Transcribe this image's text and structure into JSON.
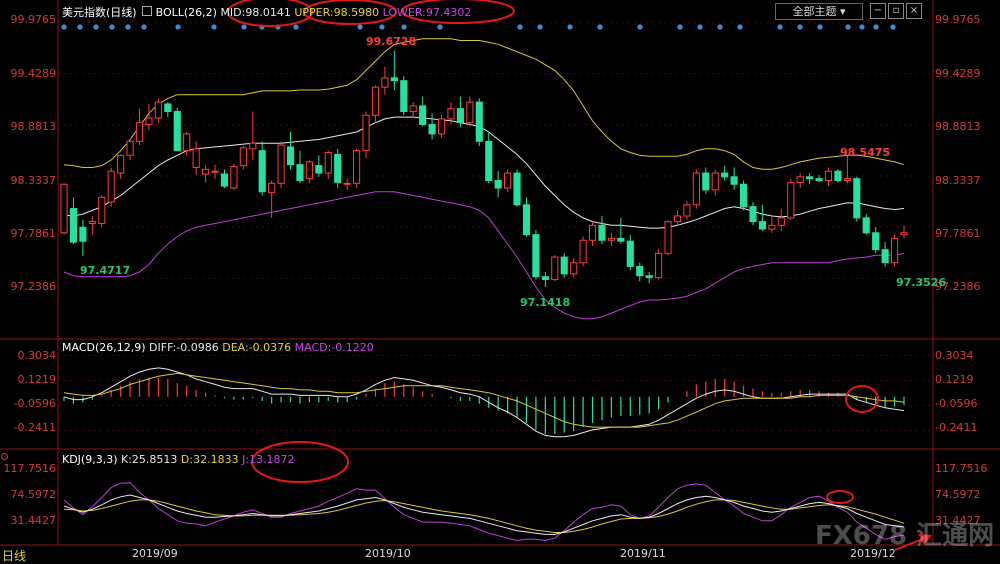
{
  "header": {
    "title": "美元指数",
    "period": "日线",
    "boll_name": "BOLL(26,2)",
    "mid": "MID:98.0141",
    "upper": "UPPER:98.5980",
    "lower": "LOWER:97.4302",
    "theme_btn": "全部主题"
  },
  "macd": {
    "name": "MACD(26,12,9)",
    "diff": "DIFF:-0.0986",
    "dea": "DEA:-0.0376",
    "macd": "MACD:-0.1220"
  },
  "kdj": {
    "name": "KDJ(9,3,3)",
    "k": "K:25.8513",
    "d": "D:32.1833",
    "j": "J:13.1872"
  },
  "axes": {
    "price": [
      "99.9765",
      "99.4289",
      "98.8813",
      "98.3337",
      "97.7861",
      "97.2386"
    ],
    "macd": [
      "0.3034",
      "0.1219",
      "-0.0596",
      "-0.2411"
    ],
    "kdj": [
      "117.7516",
      "74.5972",
      "31.4427"
    ]
  },
  "dates": [
    "2019/09",
    "2019/10",
    "2019/11",
    "2019/12"
  ],
  "bottom_tab": "日线",
  "annotations": {
    "high": "99.6728",
    "low1": "97.4717",
    "low2": "97.1418",
    "peak2": "98.5475",
    "low3": "97.3526"
  },
  "watermark": "FX678 汇通网",
  "colors": {
    "up": "#ff3b3b",
    "down": "#27e0a0",
    "mid": "#e9e9e9",
    "upper": "#d7c832",
    "lower": "#c03cd8",
    "grid": "#7a1010"
  },
  "chart_data": {
    "type": "candlestick",
    "ylim_price": [
      97.0,
      100.0
    ],
    "candles": [
      [
        97.72,
        98.25,
        97.7,
        98.24
      ],
      [
        97.98,
        98.1,
        97.6,
        97.62
      ],
      [
        97.78,
        97.86,
        97.47,
        97.63
      ],
      [
        97.82,
        97.9,
        97.7,
        97.84
      ],
      [
        97.82,
        98.12,
        97.78,
        98.1
      ],
      [
        98.05,
        98.42,
        98.0,
        98.38
      ],
      [
        98.36,
        98.56,
        98.3,
        98.55
      ],
      [
        98.55,
        98.72,
        98.5,
        98.7
      ],
      [
        98.7,
        99.05,
        98.66,
        98.9
      ],
      [
        98.88,
        99.1,
        98.82,
        98.95
      ],
      [
        98.95,
        99.16,
        98.9,
        99.12
      ],
      [
        99.1,
        99.12,
        98.96,
        99.02
      ],
      [
        99.02,
        99.06,
        98.6,
        98.6
      ],
      [
        98.6,
        98.8,
        98.55,
        98.78
      ],
      [
        98.42,
        98.7,
        98.34,
        98.62
      ],
      [
        98.35,
        98.44,
        98.26,
        98.4
      ],
      [
        98.38,
        98.45,
        98.3,
        98.38
      ],
      [
        98.35,
        98.4,
        98.2,
        98.22
      ],
      [
        98.2,
        98.46,
        98.18,
        98.43
      ],
      [
        98.44,
        98.65,
        98.4,
        98.63
      ],
      [
        98.62,
        99.02,
        98.5,
        98.68
      ],
      [
        98.6,
        98.7,
        98.12,
        98.16
      ],
      [
        98.15,
        98.28,
        97.88,
        98.25
      ],
      [
        98.25,
        98.7,
        98.2,
        98.66
      ],
      [
        98.64,
        98.8,
        98.4,
        98.45
      ],
      [
        98.45,
        98.6,
        98.25,
        98.28
      ],
      [
        98.3,
        98.5,
        98.25,
        98.48
      ],
      [
        98.44,
        98.55,
        98.32,
        98.36
      ],
      [
        98.36,
        98.6,
        98.3,
        98.58
      ],
      [
        98.56,
        98.62,
        98.2,
        98.26
      ],
      [
        98.25,
        98.3,
        98.18,
        98.25
      ],
      [
        98.25,
        98.62,
        98.2,
        98.6
      ],
      [
        98.6,
        99.02,
        98.52,
        98.98
      ],
      [
        98.98,
        99.3,
        98.9,
        99.28
      ],
      [
        99.28,
        99.5,
        99.2,
        99.38
      ],
      [
        99.38,
        99.67,
        99.25,
        99.35
      ],
      [
        99.35,
        99.4,
        98.98,
        99.02
      ],
      [
        99.02,
        99.12,
        98.95,
        99.08
      ],
      [
        99.08,
        99.18,
        98.86,
        98.88
      ],
      [
        98.88,
        99.0,
        98.72,
        98.78
      ],
      [
        98.78,
        98.98,
        98.74,
        98.94
      ],
      [
        98.94,
        99.12,
        98.88,
        99.05
      ],
      [
        99.05,
        99.18,
        98.85,
        98.9
      ],
      [
        98.9,
        99.18,
        98.86,
        99.12
      ],
      [
        99.12,
        99.16,
        98.65,
        98.7
      ],
      [
        98.7,
        98.8,
        98.25,
        98.28
      ],
      [
        98.28,
        98.38,
        98.1,
        98.2
      ],
      [
        98.2,
        98.4,
        98.16,
        98.36
      ],
      [
        98.36,
        98.4,
        98.0,
        98.02
      ],
      [
        98.02,
        98.1,
        97.68,
        97.7
      ],
      [
        97.7,
        97.75,
        97.22,
        97.25
      ],
      [
        97.25,
        97.3,
        97.14,
        97.22
      ],
      [
        97.22,
        97.48,
        97.2,
        97.46
      ],
      [
        97.46,
        97.5,
        97.24,
        97.28
      ],
      [
        97.28,
        97.45,
        97.24,
        97.4
      ],
      [
        97.4,
        97.68,
        97.36,
        97.64
      ],
      [
        97.64,
        97.84,
        97.58,
        97.8
      ],
      [
        97.8,
        97.9,
        97.6,
        97.64
      ],
      [
        97.64,
        97.72,
        97.58,
        97.66
      ],
      [
        97.66,
        97.88,
        97.6,
        97.63
      ],
      [
        97.63,
        97.7,
        97.32,
        97.36
      ],
      [
        97.36,
        97.4,
        97.2,
        97.26
      ],
      [
        97.26,
        97.3,
        97.18,
        97.24
      ],
      [
        97.24,
        97.55,
        97.22,
        97.5
      ],
      [
        97.5,
        97.85,
        97.48,
        97.84
      ],
      [
        97.84,
        97.96,
        97.8,
        97.9
      ],
      [
        97.9,
        98.06,
        97.86,
        98.02
      ],
      [
        98.02,
        98.4,
        97.98,
        98.36
      ],
      [
        98.36,
        98.42,
        98.14,
        98.18
      ],
      [
        98.18,
        98.4,
        98.12,
        98.36
      ],
      [
        98.36,
        98.44,
        98.28,
        98.32
      ],
      [
        98.32,
        98.42,
        98.18,
        98.24
      ],
      [
        98.24,
        98.28,
        97.96,
        98.0
      ],
      [
        98.0,
        98.05,
        97.8,
        97.84
      ],
      [
        97.84,
        98.02,
        97.74,
        97.76
      ],
      [
        97.76,
        97.9,
        97.72,
        97.8
      ],
      [
        97.8,
        97.98,
        97.74,
        97.88
      ],
      [
        97.88,
        98.3,
        97.86,
        98.26
      ],
      [
        98.26,
        98.36,
        98.2,
        98.32
      ],
      [
        98.32,
        98.36,
        98.24,
        98.3
      ],
      [
        98.3,
        98.34,
        98.26,
        98.28
      ],
      [
        98.28,
        98.42,
        98.22,
        98.38
      ],
      [
        98.38,
        98.4,
        98.26,
        98.28
      ],
      [
        98.28,
        98.55,
        98.25,
        98.3
      ],
      [
        98.3,
        98.32,
        97.84,
        97.88
      ],
      [
        97.88,
        97.92,
        97.7,
        97.72
      ],
      [
        97.72,
        97.78,
        97.5,
        97.54
      ],
      [
        97.54,
        97.62,
        97.36,
        97.4
      ],
      [
        97.4,
        97.7,
        97.36,
        97.66
      ],
      [
        97.7,
        97.8,
        97.66,
        97.72
      ]
    ],
    "mid_line": [
      97.91,
      97.9,
      97.92,
      97.96,
      98.0,
      98.06,
      98.12,
      98.2,
      98.28,
      98.36,
      98.44,
      98.5,
      98.55,
      98.6,
      98.62,
      98.63,
      98.64,
      98.65,
      98.66,
      98.67,
      98.68,
      98.68,
      98.68,
      98.68,
      98.69,
      98.7,
      98.71,
      98.72,
      98.74,
      98.76,
      98.78,
      98.8,
      98.85,
      98.9,
      98.94,
      98.96,
      98.96,
      98.96,
      98.95,
      98.94,
      98.93,
      98.92,
      98.9,
      98.88,
      98.86,
      98.8,
      98.72,
      98.64,
      98.56,
      98.46,
      98.34,
      98.22,
      98.12,
      98.02,
      97.94,
      97.88,
      97.84,
      97.82,
      97.8,
      97.8,
      97.79,
      97.78,
      97.77,
      97.77,
      97.78,
      97.8,
      97.83,
      97.86,
      97.9,
      97.94,
      97.98,
      98.0,
      97.98,
      97.95,
      97.92,
      97.9,
      97.89,
      97.9,
      97.92,
      97.95,
      97.98,
      98.0,
      98.02,
      98.04,
      98.04,
      98.02,
      98.0,
      97.98,
      97.97,
      97.98
    ],
    "upper_line": [
      98.45,
      98.44,
      98.42,
      98.42,
      98.44,
      98.5,
      98.6,
      98.72,
      98.86,
      99.0,
      99.1,
      99.16,
      99.2,
      99.2,
      99.2,
      99.2,
      99.2,
      99.2,
      99.2,
      99.2,
      99.22,
      99.24,
      99.24,
      99.24,
      99.24,
      99.25,
      99.25,
      99.25,
      99.26,
      99.28,
      99.3,
      99.36,
      99.46,
      99.56,
      99.66,
      99.74,
      99.76,
      99.78,
      99.8,
      99.8,
      99.8,
      99.8,
      99.78,
      99.78,
      99.78,
      99.76,
      99.74,
      99.7,
      99.66,
      99.62,
      99.58,
      99.52,
      99.46,
      99.36,
      99.24,
      99.08,
      98.92,
      98.8,
      98.7,
      98.62,
      98.58,
      98.55,
      98.54,
      98.54,
      98.54,
      98.54,
      98.56,
      98.6,
      98.62,
      98.62,
      98.6,
      98.56,
      98.48,
      98.42,
      98.4,
      98.4,
      98.42,
      98.45,
      98.48,
      98.5,
      98.52,
      98.53,
      98.54,
      98.55,
      98.55,
      98.54,
      98.52,
      98.5,
      98.48,
      98.45
    ],
    "lower_line": [
      97.3,
      97.26,
      97.25,
      97.25,
      97.25,
      97.25,
      97.25,
      97.26,
      97.3,
      97.38,
      97.5,
      97.6,
      97.68,
      97.74,
      97.78,
      97.8,
      97.82,
      97.84,
      97.86,
      97.88,
      97.9,
      97.92,
      97.94,
      97.96,
      97.98,
      98.0,
      98.02,
      98.04,
      98.06,
      98.08,
      98.1,
      98.12,
      98.14,
      98.16,
      98.16,
      98.16,
      98.14,
      98.12,
      98.1,
      98.08,
      98.06,
      98.04,
      98.02,
      98.0,
      97.96,
      97.88,
      97.74,
      97.6,
      97.46,
      97.3,
      97.14,
      97.0,
      96.92,
      96.86,
      96.82,
      96.8,
      96.8,
      96.82,
      96.86,
      96.9,
      96.94,
      96.98,
      97.0,
      97.0,
      97.01,
      97.02,
      97.04,
      97.08,
      97.12,
      97.18,
      97.24,
      97.3,
      97.34,
      97.36,
      97.38,
      97.4,
      97.4,
      97.4,
      97.4,
      97.4,
      97.4,
      97.4,
      97.42,
      97.44,
      97.45,
      97.46,
      97.48,
      97.48,
      97.48,
      97.5
    ],
    "macd_ylim": [
      -0.35,
      0.34
    ],
    "macd_hist": [
      -0.03,
      -0.05,
      -0.04,
      -0.02,
      0.01,
      0.05,
      0.08,
      0.11,
      0.13,
      0.14,
      0.14,
      0.13,
      0.1,
      0.08,
      0.05,
      0.03,
      0.01,
      -0.01,
      -0.02,
      -0.02,
      -0.01,
      -0.03,
      -0.05,
      -0.04,
      -0.04,
      -0.05,
      -0.04,
      -0.04,
      -0.03,
      -0.04,
      -0.04,
      -0.02,
      0.02,
      0.06,
      0.1,
      0.11,
      0.09,
      0.07,
      0.04,
      0.02,
      0.0,
      -0.01,
      -0.03,
      -0.03,
      -0.05,
      -0.08,
      -0.1,
      -0.12,
      -0.15,
      -0.19,
      -0.24,
      -0.27,
      -0.27,
      -0.26,
      -0.25,
      -0.22,
      -0.19,
      -0.17,
      -0.15,
      -0.14,
      -0.14,
      -0.13,
      -0.12,
      -0.09,
      -0.04,
      0.0,
      0.04,
      0.09,
      0.11,
      0.13,
      0.13,
      0.11,
      0.08,
      0.06,
      0.04,
      0.03,
      0.03,
      0.04,
      0.05,
      0.05,
      0.04,
      0.03,
      0.03,
      0.02,
      -0.02,
      -0.04,
      -0.06,
      -0.08,
      -0.07,
      -0.06
    ],
    "macd_diff": [
      0.0,
      -0.02,
      -0.02,
      0.0,
      0.03,
      0.07,
      0.11,
      0.15,
      0.18,
      0.2,
      0.21,
      0.2,
      0.18,
      0.16,
      0.13,
      0.11,
      0.09,
      0.07,
      0.06,
      0.06,
      0.06,
      0.04,
      0.02,
      0.02,
      0.02,
      0.01,
      0.01,
      0.01,
      0.01,
      0.0,
      0.0,
      0.02,
      0.05,
      0.09,
      0.12,
      0.14,
      0.13,
      0.12,
      0.1,
      0.08,
      0.07,
      0.05,
      0.03,
      0.02,
      0.0,
      -0.04,
      -0.08,
      -0.11,
      -0.15,
      -0.2,
      -0.25,
      -0.28,
      -0.29,
      -0.29,
      -0.28,
      -0.26,
      -0.24,
      -0.23,
      -0.22,
      -0.22,
      -0.22,
      -0.21,
      -0.2,
      -0.17,
      -0.13,
      -0.09,
      -0.05,
      -0.01,
      0.02,
      0.04,
      0.05,
      0.04,
      0.02,
      0.0,
      -0.01,
      -0.01,
      -0.01,
      0.0,
      0.01,
      0.02,
      0.02,
      0.02,
      0.02,
      0.02,
      -0.02,
      -0.04,
      -0.06,
      -0.08,
      -0.09,
      -0.1
    ],
    "macd_dea": [
      0.03,
      0.02,
      0.01,
      0.01,
      0.02,
      0.04,
      0.06,
      0.09,
      0.11,
      0.13,
      0.15,
      0.16,
      0.17,
      0.16,
      0.15,
      0.14,
      0.13,
      0.12,
      0.11,
      0.1,
      0.09,
      0.08,
      0.07,
      0.06,
      0.06,
      0.05,
      0.05,
      0.04,
      0.04,
      0.03,
      0.03,
      0.03,
      0.04,
      0.05,
      0.06,
      0.07,
      0.08,
      0.08,
      0.08,
      0.08,
      0.08,
      0.07,
      0.06,
      0.05,
      0.04,
      0.03,
      0.01,
      -0.01,
      -0.03,
      -0.06,
      -0.09,
      -0.12,
      -0.15,
      -0.18,
      -0.2,
      -0.21,
      -0.22,
      -0.22,
      -0.22,
      -0.22,
      -0.22,
      -0.22,
      -0.21,
      -0.2,
      -0.19,
      -0.17,
      -0.14,
      -0.11,
      -0.08,
      -0.05,
      -0.03,
      -0.02,
      -0.01,
      -0.01,
      -0.01,
      -0.01,
      -0.01,
      -0.01,
      0.0,
      0.0,
      0.01,
      0.01,
      0.01,
      0.01,
      0.0,
      -0.01,
      -0.02,
      -0.03,
      -0.03,
      -0.04
    ],
    "kdj_ylim": [
      0,
      130
    ],
    "kdj_k": [
      60,
      55,
      50,
      55,
      62,
      70,
      75,
      78,
      74,
      70,
      64,
      58,
      52,
      48,
      45,
      42,
      42,
      43,
      44,
      46,
      48,
      46,
      44,
      44,
      46,
      48,
      50,
      52,
      56,
      60,
      65,
      70,
      72,
      74,
      70,
      64,
      58,
      54,
      50,
      48,
      46,
      44,
      42,
      40,
      36,
      32,
      28,
      24,
      20,
      18,
      16,
      14,
      14,
      18,
      24,
      30,
      36,
      40,
      44,
      46,
      42,
      40,
      42,
      48,
      56,
      64,
      70,
      74,
      76,
      74,
      70,
      66,
      60,
      56,
      52,
      50,
      52,
      56,
      60,
      64,
      66,
      64,
      60,
      56,
      48,
      42,
      36,
      30,
      28,
      26
    ],
    "kdj_d": [
      55,
      54,
      52,
      53,
      56,
      60,
      64,
      68,
      70,
      70,
      68,
      64,
      60,
      56,
      52,
      49,
      46,
      45,
      44,
      44,
      45,
      45,
      45,
      45,
      45,
      46,
      47,
      48,
      50,
      53,
      57,
      61,
      65,
      68,
      69,
      67,
      64,
      61,
      58,
      55,
      52,
      50,
      48,
      46,
      43,
      40,
      36,
      32,
      28,
      24,
      21,
      19,
      17,
      17,
      19,
      22,
      26,
      31,
      35,
      39,
      40,
      40,
      41,
      43,
      47,
      52,
      58,
      63,
      67,
      70,
      70,
      69,
      66,
      63,
      60,
      57,
      55,
      55,
      57,
      59,
      61,
      62,
      61,
      59,
      55,
      51,
      47,
      42,
      37,
      32
    ],
    "kdj_j": [
      70,
      57,
      46,
      59,
      74,
      90,
      97,
      98,
      82,
      70,
      56,
      46,
      36,
      32,
      31,
      28,
      34,
      39,
      44,
      50,
      54,
      48,
      42,
      42,
      48,
      52,
      56,
      60,
      68,
      74,
      81,
      88,
      86,
      86,
      72,
      58,
      46,
      40,
      34,
      34,
      34,
      32,
      30,
      28,
      22,
      16,
      12,
      8,
      4,
      6,
      6,
      4,
      8,
      20,
      34,
      46,
      56,
      58,
      62,
      60,
      46,
      40,
      44,
      58,
      74,
      88,
      94,
      96,
      94,
      82,
      70,
      60,
      48,
      42,
      36,
      36,
      46,
      58,
      66,
      74,
      76,
      68,
      58,
      50,
      34,
      24,
      14,
      6,
      10,
      13
    ]
  }
}
